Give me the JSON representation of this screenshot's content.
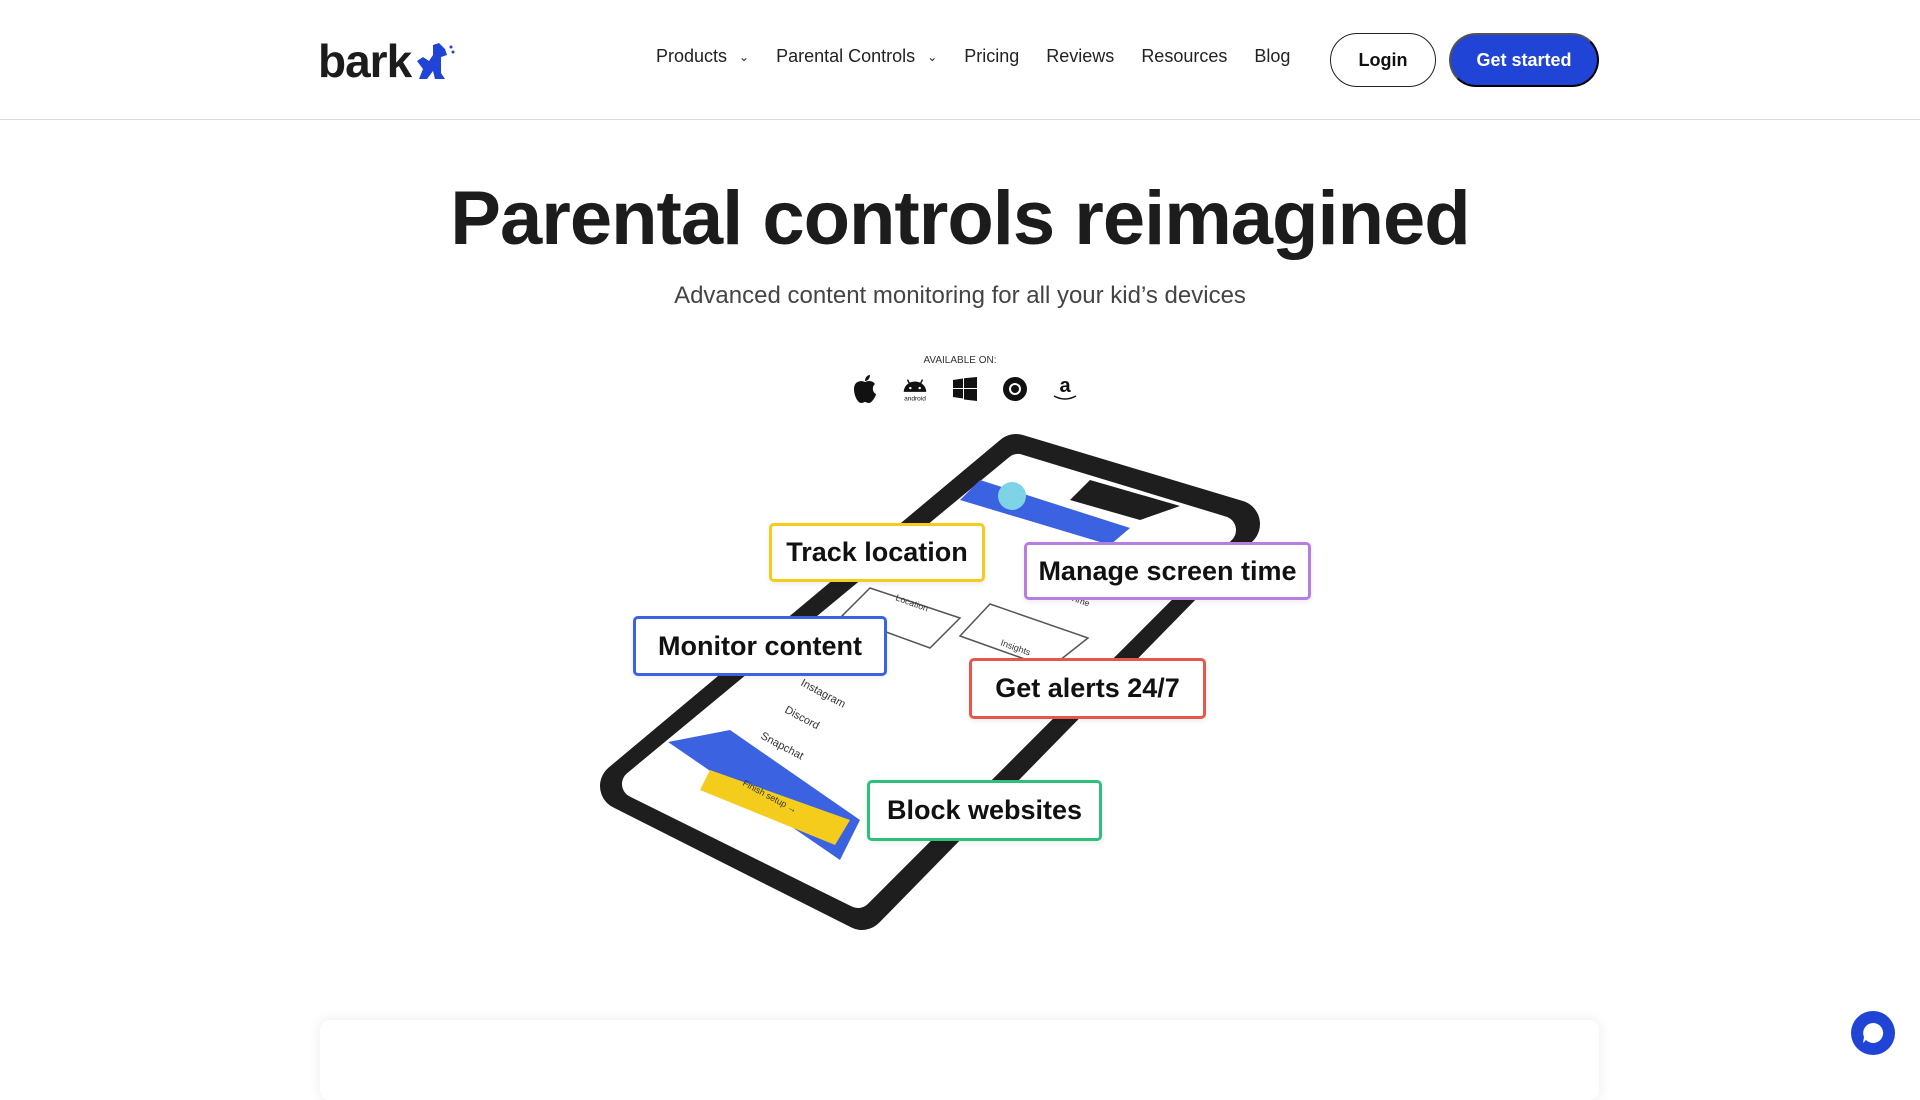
{
  "header": {
    "logo": "bark",
    "nav": [
      {
        "label": "Products",
        "dropdown": true
      },
      {
        "label": "Parental Controls",
        "dropdown": true
      },
      {
        "label": "Pricing"
      },
      {
        "label": "Reviews"
      },
      {
        "label": "Resources"
      },
      {
        "label": "Blog"
      }
    ],
    "login": "Login",
    "get_started": "Get started"
  },
  "hero": {
    "title": "Parental controls reimagined",
    "subtitle": "Advanced content monitoring for all your kid’s devices",
    "available_on": "AVAILABLE ON:",
    "platforms": [
      "apple-icon",
      "android-icon",
      "windows-icon",
      "chrome-icon",
      "amazon-icon"
    ],
    "android_label": "android",
    "features": [
      "Track location",
      "Manage screen time",
      "Monitor content",
      "Get alerts 24/7",
      "Block websites"
    ],
    "phone_screen": {
      "apps": [
        "Instagram",
        "Discord",
        "Snapchat"
      ],
      "tiles": [
        "Location",
        "Insights",
        "Time"
      ],
      "cta": "Finish setup →"
    }
  },
  "colors": {
    "brand": "#1f44d6",
    "yellow": "#f4cc1c",
    "purple": "#b57ee0",
    "blue": "#3b62e0",
    "red": "#e5574b",
    "green": "#2cc07a"
  }
}
